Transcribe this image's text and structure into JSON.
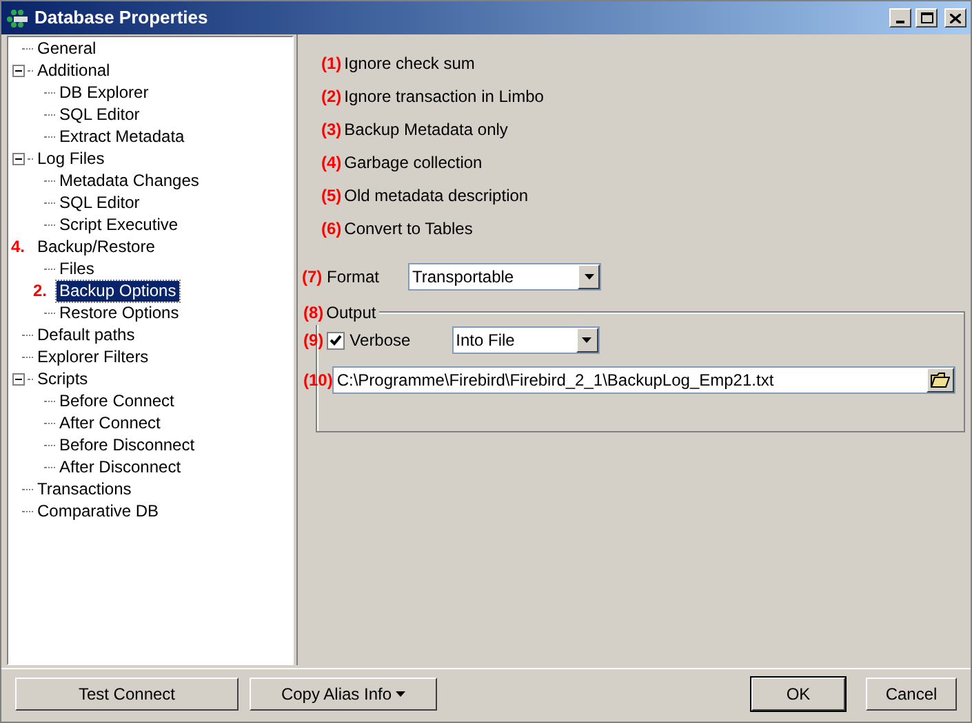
{
  "window": {
    "title": "Database Properties"
  },
  "tree": [
    {
      "label": "General"
    },
    {
      "label": "Additional",
      "expanded": true,
      "children": [
        {
          "label": "DB Explorer"
        },
        {
          "label": "SQL Editor"
        },
        {
          "label": "Extract Metadata"
        }
      ]
    },
    {
      "label": "Log Files",
      "expanded": true,
      "children": [
        {
          "label": "Metadata Changes"
        },
        {
          "label": "SQL Editor"
        },
        {
          "label": "Script Executive"
        }
      ]
    },
    {
      "label": "Backup/Restore",
      "marker": "4.",
      "children": [
        {
          "label": "Files",
          "selected": false
        },
        {
          "label": "Backup Options",
          "marker": "2.",
          "selected": true
        },
        {
          "label": "Restore Options",
          "selected": false
        }
      ]
    },
    {
      "label": "Default paths"
    },
    {
      "label": "Explorer Filters"
    },
    {
      "label": "Scripts",
      "expanded": true,
      "children": [
        {
          "label": "Before Connect"
        },
        {
          "label": "After Connect"
        },
        {
          "label": "Before Disconnect"
        },
        {
          "label": "After Disconnect"
        }
      ]
    },
    {
      "label": "Transactions"
    },
    {
      "label": "Comparative DB"
    }
  ],
  "options": [
    {
      "marker": "(1)",
      "label": "Ignore check sum"
    },
    {
      "marker": "(2)",
      "label": "Ignore transaction in Limbo"
    },
    {
      "marker": "(3)",
      "label": "Backup Metadata only"
    },
    {
      "marker": "(4)",
      "label": "Garbage collection"
    },
    {
      "marker": "(5)",
      "label": "Old metadata description"
    },
    {
      "marker": "(6)",
      "label": "Convert to Tables"
    }
  ],
  "format": {
    "marker": "(7)",
    "label": "Format",
    "value": "Transportable"
  },
  "output": {
    "marker": "(8)",
    "label": "Output",
    "verbose_marker": "(9)",
    "verbose_label": "Verbose",
    "verbose_checked": true,
    "mode": "Into File",
    "path_marker": "(10)",
    "path": "C:\\Programme\\Firebird\\Firebird_2_1\\BackupLog_Emp21.txt"
  },
  "buttons": [
    {
      "label": "Test Connect",
      "kind": "plain"
    },
    {
      "label": "Copy Alias Info",
      "kind": "menu"
    },
    {
      "label": "OK",
      "kind": "default"
    },
    {
      "label": "Cancel",
      "kind": "plain"
    }
  ]
}
